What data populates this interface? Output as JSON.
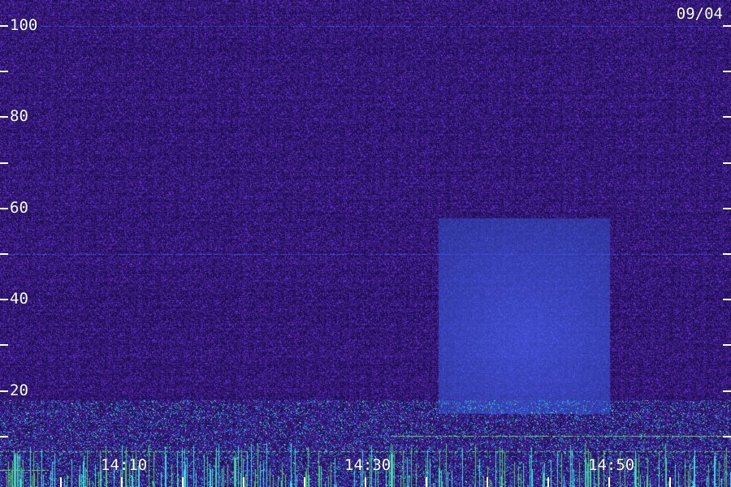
{
  "chart_data": {
    "type": "heatmap",
    "title": "",
    "date": "09/04",
    "y_tick_labels": [
      "100",
      "80",
      "60",
      "40",
      "20"
    ],
    "y_tick_values": [
      100,
      80,
      60,
      40,
      20
    ],
    "y_minor_tick_values": [
      90,
      70,
      50,
      30,
      10
    ],
    "ylim": [
      0,
      105
    ],
    "x_tick_labels": [
      "14:10",
      "14:30",
      "14:50"
    ],
    "x_tick_values_min": [
      10,
      30,
      50
    ],
    "x_minor_tick_values_min": [
      0,
      5,
      15,
      20,
      25,
      35,
      40,
      45,
      55
    ],
    "xlim_min": [
      0,
      60
    ],
    "colors": {
      "background": "#2a1a8c",
      "noise_high": "#5a3ce0",
      "hotspot": "#3c46e6",
      "band_cyan": "#26c8e6",
      "band_green": "#6cf08c",
      "tick": "#ffffff"
    },
    "features": [
      {
        "kind": "broadband_patch",
        "x_min": [
          36,
          50
        ],
        "y": [
          15,
          58
        ]
      },
      {
        "kind": "low_freq_band",
        "y": [
          0,
          18
        ]
      },
      {
        "kind": "horizontal_line",
        "y": 100
      },
      {
        "kind": "horizontal_line",
        "y": 50
      }
    ]
  }
}
